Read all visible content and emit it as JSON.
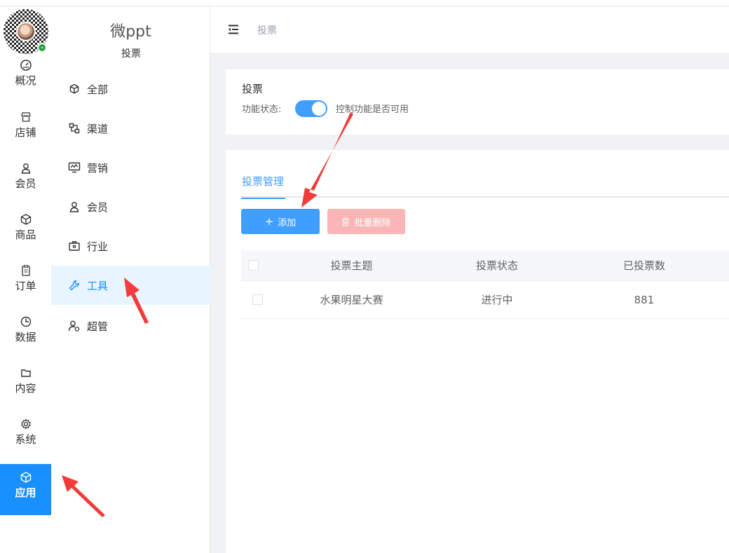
{
  "rail": {
    "items": [
      {
        "label": "概况",
        "icon": "dashboard-icon"
      },
      {
        "label": "店铺",
        "icon": "shop-icon"
      },
      {
        "label": "会员",
        "icon": "user-icon"
      },
      {
        "label": "商品",
        "icon": "box-icon"
      },
      {
        "label": "订单",
        "icon": "clipboard-icon"
      },
      {
        "label": "数据",
        "icon": "pie-chart-icon"
      },
      {
        "label": "内容",
        "icon": "folder-icon"
      },
      {
        "label": "系统",
        "icon": "gear-icon"
      },
      {
        "label": "应用",
        "icon": "cube-icon",
        "active": true
      }
    ]
  },
  "submenu": {
    "brand": "微ppt",
    "brand_sub": "投票",
    "items": [
      {
        "label": "全部",
        "icon": "cube-icon"
      },
      {
        "label": "渠道",
        "icon": "channel-icon"
      },
      {
        "label": "营销",
        "icon": "monitor-chart-icon"
      },
      {
        "label": "会员",
        "icon": "user-icon"
      },
      {
        "label": "行业",
        "icon": "briefcase-icon"
      },
      {
        "label": "工具",
        "icon": "wrench-icon",
        "active": true
      },
      {
        "label": "超管",
        "icon": "admin-user-icon"
      }
    ]
  },
  "header": {
    "breadcrumb": "投票"
  },
  "feature": {
    "title": "投票",
    "status_label": "功能状态:",
    "enabled": true,
    "description": "控制功能是否可用"
  },
  "manage": {
    "tab": "投票管理",
    "add_label": "添加",
    "batch_delete_label": "批量删除",
    "columns": [
      "投票主题",
      "投票状态",
      "已投票数"
    ],
    "rows": [
      {
        "topic": "水果明星大赛",
        "status": "进行中",
        "count": "881"
      }
    ]
  },
  "colors": {
    "primary": "#409eff",
    "rail_active": "#1890ff",
    "danger_disabled": "#fab6b6",
    "arrow": "#f23b3b"
  }
}
